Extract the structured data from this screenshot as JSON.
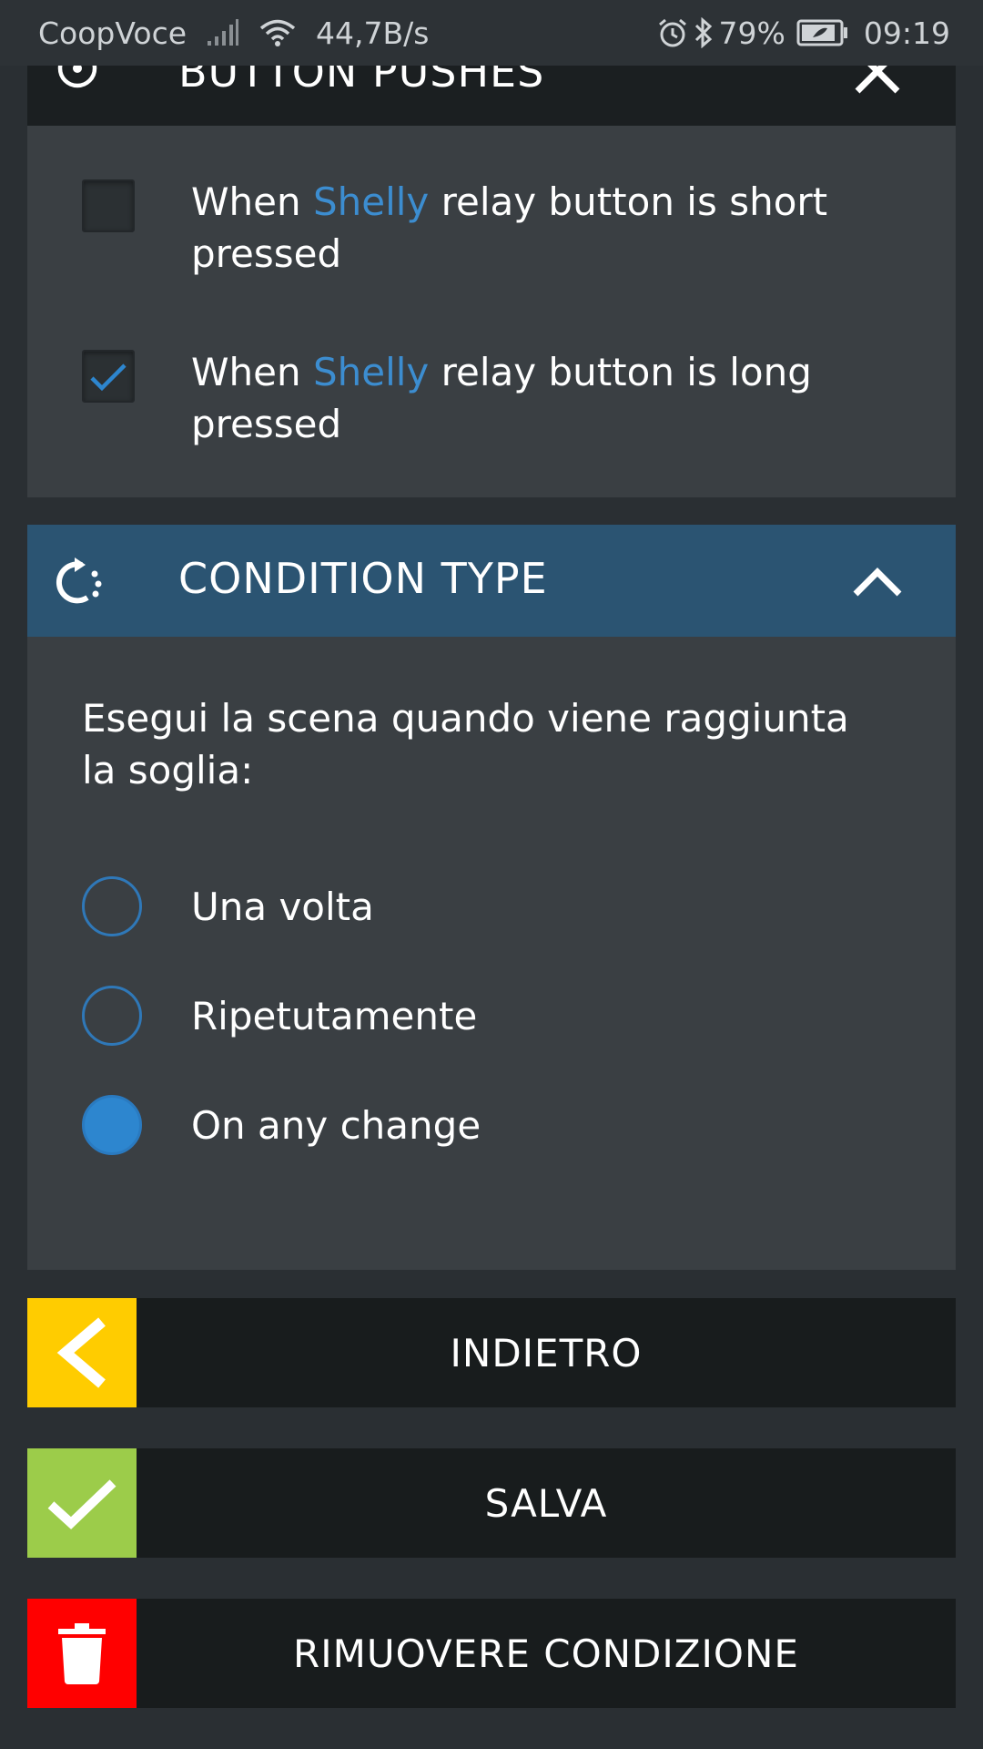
{
  "status_bar": {
    "carrier": "CoopVoce",
    "speed": "44,7B/s",
    "battery": "79%",
    "time": "09:19"
  },
  "button_pushes": {
    "title": "BUTTON PUSHES",
    "options": [
      {
        "prefix": "When ",
        "highlight": "Shelly",
        "suffix": " relay button is short pressed",
        "checked": false
      },
      {
        "prefix": "When ",
        "highlight": "Shelly",
        "suffix": " relay button is long pressed",
        "checked": true
      }
    ]
  },
  "condition_type": {
    "title": "CONDITION TYPE",
    "prompt": "Esegui la scena quando viene raggiunta la soglia:",
    "options": [
      {
        "label": "Una volta",
        "selected": false
      },
      {
        "label": "Ripetutamente",
        "selected": false
      },
      {
        "label": "On any change",
        "selected": true
      }
    ]
  },
  "actions": {
    "back": "INDIETRO",
    "save": "SALVA",
    "remove": "RIMUOVERE CONDIZIONE"
  },
  "colors": {
    "accent_blue": "#2d86cf",
    "header_blue": "#2b5472",
    "back_yellow": "#ffcc00",
    "save_green": "#9ccc4a",
    "remove_red": "#ff0000"
  }
}
